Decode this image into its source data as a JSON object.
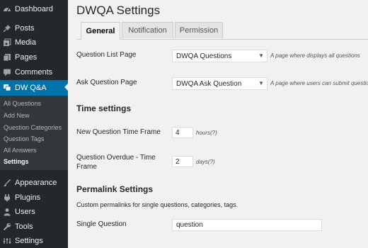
{
  "sidebar": {
    "items": [
      {
        "label": "Dashboard",
        "icon": "dashboard-icon"
      },
      {
        "label": "Posts",
        "icon": "pushpin-icon"
      },
      {
        "label": "Media",
        "icon": "media-icon"
      },
      {
        "label": "Pages",
        "icon": "pages-icon"
      },
      {
        "label": "Comments",
        "icon": "comments-icon"
      },
      {
        "label": "DW Q&A",
        "icon": "dwqa-icon"
      }
    ],
    "submenu": [
      "All Questions",
      "Add New",
      "Question Categories",
      "Question Tags",
      "All Answers",
      "Settings"
    ],
    "bottom_items": [
      {
        "label": "Appearance",
        "icon": "appearance-icon"
      },
      {
        "label": "Plugins",
        "icon": "plugins-icon"
      },
      {
        "label": "Users",
        "icon": "users-icon"
      },
      {
        "label": "Tools",
        "icon": "tools-icon"
      },
      {
        "label": "Settings",
        "icon": "settings-icon"
      }
    ]
  },
  "page": {
    "title": "DWQA Settings",
    "tabs": [
      "General",
      "Notification",
      "Permission"
    ],
    "question_list_page": {
      "label": "Question List Page",
      "value": "DWQA Questions",
      "desc": "A page where displays all questions"
    },
    "ask_question_page": {
      "label": "Ask Question Page",
      "value": "DWQA Ask Question",
      "desc": "A page where users can submit question"
    },
    "time_settings": {
      "heading": "Time settings",
      "new_question": {
        "label": "New Question Time Frame",
        "value": "4",
        "unit": "hours(?)"
      },
      "overdue": {
        "label": "Question Overdue - Time Frame",
        "value": "2",
        "unit": "days(?)"
      }
    },
    "permalink": {
      "heading": "Permalink Settings",
      "help": "Custom permalinks for single questions, categories, tags.",
      "single_question": {
        "label": "Single Question",
        "value": "question"
      }
    }
  },
  "colors": {
    "sidebar_bg": "#23282d",
    "accent": "#0073aa",
    "page_bg": "#f1f1f1"
  }
}
